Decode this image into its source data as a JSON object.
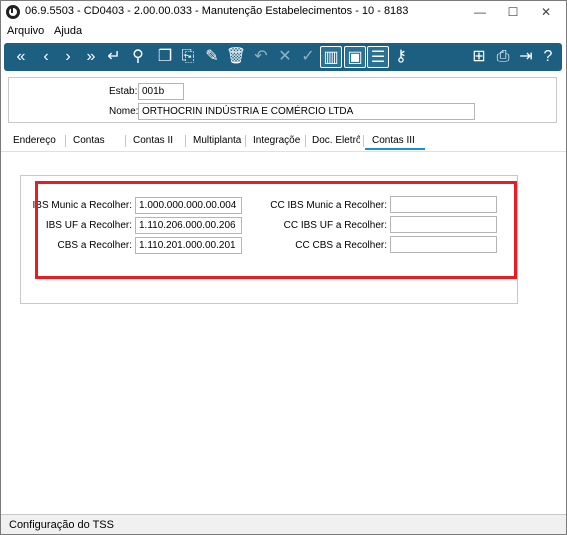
{
  "window": {
    "title": "06.9.5503 - CD0403 - 2.00.00.033 - Manutenção Estabelecimentos - 10 - 8183",
    "minimize": "—",
    "maximize": "☐",
    "close": "✕"
  },
  "menu": {
    "arquivo": "Arquivo",
    "ajuda": "Ajuda"
  },
  "toolbar": {
    "icons": [
      "first-icon",
      "prev-icon",
      "next-icon",
      "last-icon",
      "goto-icon",
      "search-icon",
      "new-icon",
      "copy-icon",
      "edit-icon",
      "delete-icon",
      "undo-icon",
      "cancel-icon",
      "confirm-icon",
      "book-icon",
      "window-icon",
      "filter-icon",
      "key-icon",
      "tree-icon",
      "print-icon",
      "exit-icon",
      "help-icon"
    ]
  },
  "header": {
    "estab_label": "Estab:",
    "estab_value": "001b",
    "nome_label": "Nome:",
    "nome_value": "ORTHOCRIN INDÚSTRIA E COMÉRCIO LTDA"
  },
  "tabs": [
    "Endereço",
    "Contas",
    "Contas II",
    "Multiplanta",
    "Integraçõe",
    "Doc. Eletrô",
    "Contas III"
  ],
  "active_tab": "Contas III",
  "form": {
    "ibs_munic_label": "IBS Munic a Recolher:",
    "ibs_munic_value": "1.000.000.000.00.004",
    "ibs_uf_label": "IBS UF a Recolher:",
    "ibs_uf_value": "1.110.206.000.00.206",
    "cbs_label": "CBS a Recolher:",
    "cbs_value": "1.110.201.000.00.201",
    "cc_ibs_munic_label": "CC IBS Munic a Recolher:",
    "cc_ibs_munic_value": "",
    "cc_ibs_uf_label": "CC IBS UF a Recolher:",
    "cc_ibs_uf_value": "",
    "cc_cbs_label": "CC CBS a Recolher:",
    "cc_cbs_value": ""
  },
  "highlight_color": "#e81c24",
  "toolbar_color": "#1d5f80",
  "status": {
    "text": "Configuração do TSS"
  }
}
